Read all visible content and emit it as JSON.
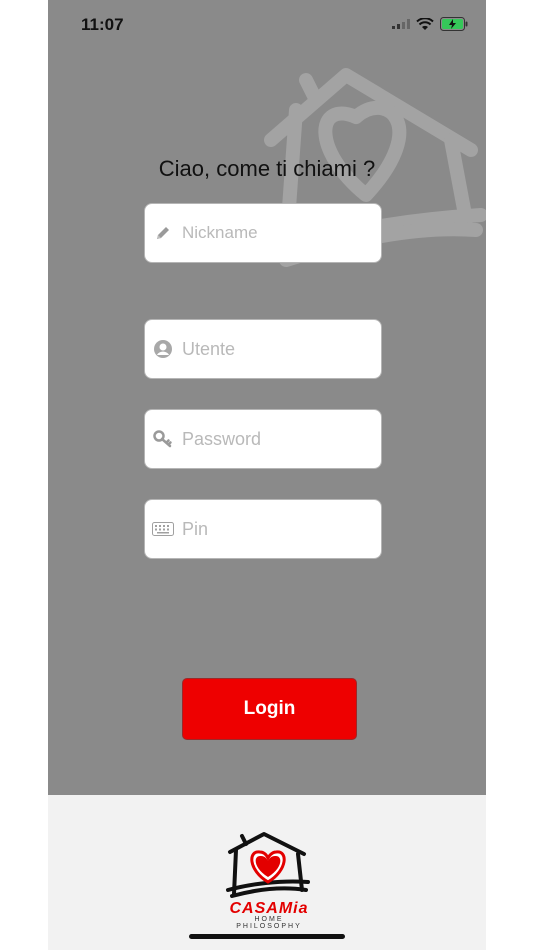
{
  "status": {
    "time": "11:07"
  },
  "form": {
    "greeting": "Ciao, come ti chiami ?",
    "nickname_placeholder": "Nickname",
    "user_placeholder": "Utente",
    "password_placeholder": "Password",
    "pin_placeholder": "Pin",
    "login_label": "Login"
  },
  "brand": {
    "name": "CASAMia",
    "tagline": "HOME PHILOSOPHY"
  },
  "colors": {
    "background": "#8a8a8a",
    "accent": "#ee0000",
    "footer": "#f2f2f2"
  },
  "icons": {
    "nickname": "pencil-icon",
    "user": "user-circle-icon",
    "password": "key-icon",
    "pin": "keyboard-icon"
  }
}
